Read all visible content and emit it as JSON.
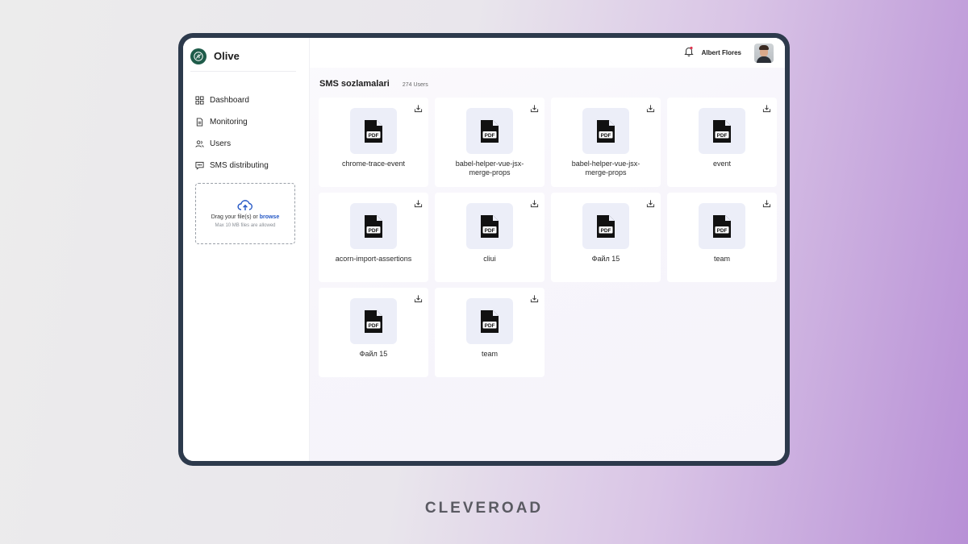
{
  "app": {
    "name": "Olive"
  },
  "sidebar": {
    "items": [
      {
        "label": "Dashboard",
        "icon": "dashboard-icon"
      },
      {
        "label": "Monitoring",
        "icon": "document-icon"
      },
      {
        "label": "Users",
        "icon": "users-icon"
      },
      {
        "label": "SMS distributing",
        "icon": "chat-icon"
      }
    ],
    "upload": {
      "text": "Drag your file(s) or",
      "browse": "browse",
      "limit": "Max 10 MB files are allowed",
      "icon": "cloud-upload-icon"
    }
  },
  "header": {
    "user_name": "Albert Flores",
    "notification_icon": "bell-icon"
  },
  "main": {
    "title": "SMS sozlamalari",
    "count": "274 Users",
    "files": [
      {
        "name": "chrome-trace-event"
      },
      {
        "name": "babel-helper-vue-jsx-merge-props"
      },
      {
        "name": "babel-helper-vue-jsx-merge-props"
      },
      {
        "name": "event"
      },
      {
        "name": "acorn-import-assertions"
      },
      {
        "name": "cliui"
      },
      {
        "name": "Файл 15"
      },
      {
        "name": "team"
      },
      {
        "name": "Файл 15"
      },
      {
        "name": "team"
      }
    ],
    "file_badge": "PDF"
  },
  "footer": {
    "brand": "CLEVEROAD"
  },
  "colors": {
    "logo": "#1f5c4a",
    "device_frame": "#2d3a4c",
    "browse_link": "#2457c5",
    "bell_accent": "#e0344f"
  }
}
